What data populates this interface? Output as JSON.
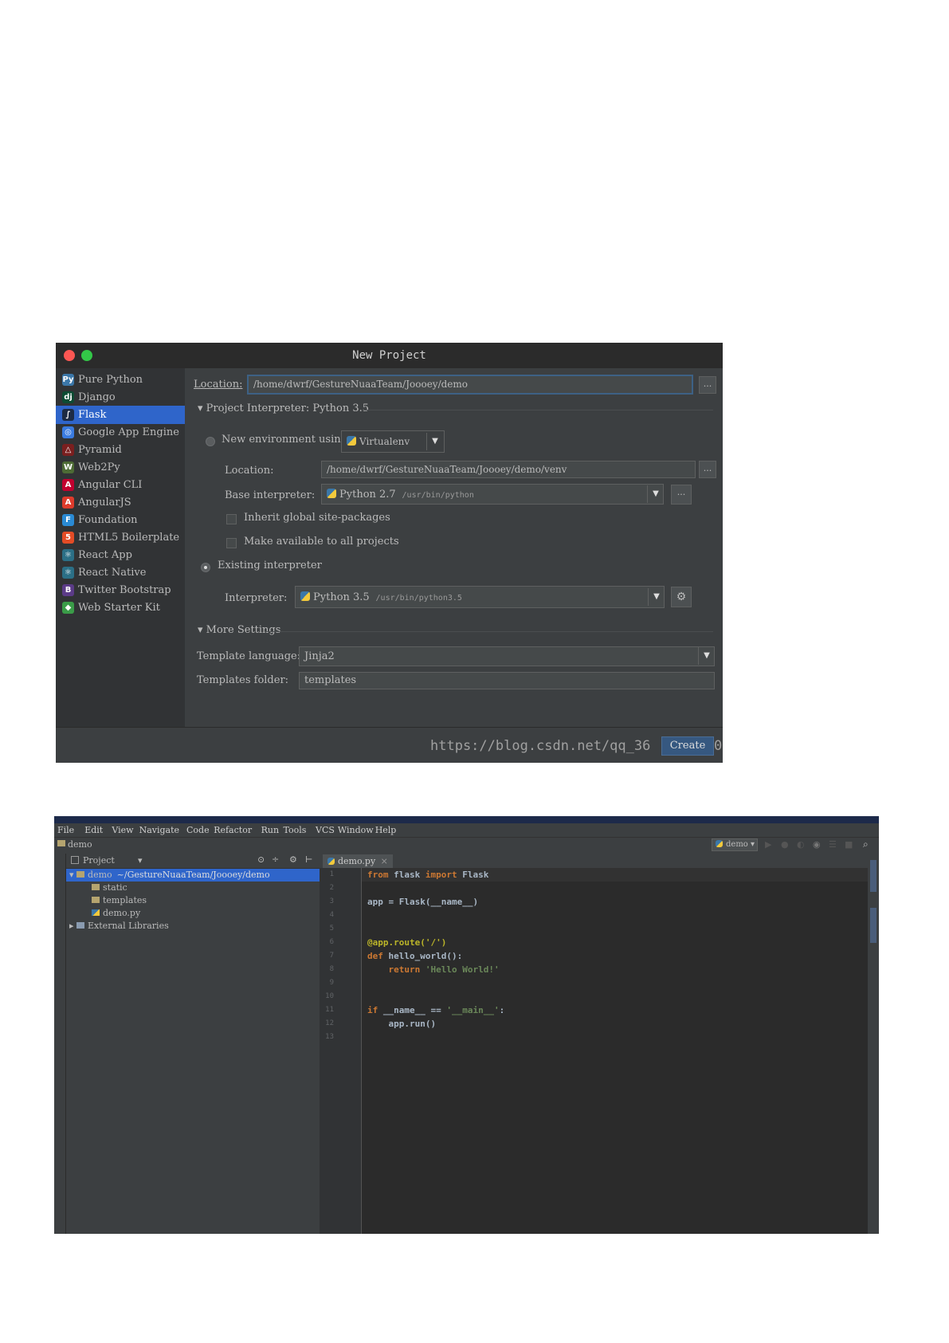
{
  "dialog": {
    "title": "New Project",
    "project_types": [
      {
        "label": "Pure Python",
        "icon": "python-icon"
      },
      {
        "label": "Django",
        "icon": "django-icon"
      },
      {
        "label": "Flask",
        "icon": "flask-icon"
      },
      {
        "label": "Google App Engine",
        "icon": "google-app-engine-icon"
      },
      {
        "label": "Pyramid",
        "icon": "pyramid-icon"
      },
      {
        "label": "Web2Py",
        "icon": "web2py-icon"
      },
      {
        "label": "Angular CLI",
        "icon": "angular-cli-icon"
      },
      {
        "label": "AngularJS",
        "icon": "angularjs-icon"
      },
      {
        "label": "Foundation",
        "icon": "foundation-icon"
      },
      {
        "label": "HTML5 Boilerplate",
        "icon": "html5-icon"
      },
      {
        "label": "React App",
        "icon": "react-icon"
      },
      {
        "label": "React Native",
        "icon": "react-native-icon"
      },
      {
        "label": "Twitter Bootstrap",
        "icon": "bootstrap-icon"
      },
      {
        "label": "Web Starter Kit",
        "icon": "web-starter-kit-icon"
      }
    ],
    "selected_type": "Flask",
    "location_label": "Location:",
    "location_value": "/home/dwrf/GestureNuaaTeam/Joooey/demo",
    "browse_label": "...",
    "interpreter_section": "Project Interpreter: Python 3.5",
    "new_env_label": "New environment using",
    "new_env_tool": "Virtualenv",
    "venv_location_label": "Location:",
    "venv_location_value": "/home/dwrf/GestureNuaaTeam/Joooey/demo/venv",
    "base_interp_label": "Base interpreter:",
    "base_interp_name": "Python 2.7",
    "base_interp_path": "/usr/bin/python",
    "inherit_label": "Inherit global site-packages",
    "make_available_label": "Make available to all projects",
    "existing_label": "Existing interpreter",
    "interp_label": "Interpreter:",
    "interp_name": "Python 3.5",
    "interp_path": "/usr/bin/python3.5",
    "more_settings": "More Settings",
    "template_lang_label": "Template language:",
    "template_lang_value": "Jinja2",
    "templates_folder_label": "Templates folder:",
    "templates_folder_value": "templates",
    "watermark": "https://blog.csdn.net/qq_36",
    "watermark_tail": "0",
    "create_label": "Create"
  },
  "ide": {
    "menu": [
      "File",
      "Edit",
      "View",
      "Navigate",
      "Code",
      "Refactor",
      "Run",
      "Tools",
      "VCS",
      "Window",
      "Help"
    ],
    "breadcrumb": "demo",
    "run_config": "demo",
    "project_header": "Project",
    "tree": [
      {
        "label": "demo",
        "detail": "~/GestureNuaaTeam/Joooey/demo",
        "indent": 0,
        "kind": "folder",
        "expanded": true,
        "selected": true
      },
      {
        "label": "static",
        "detail": "",
        "indent": 2,
        "kind": "folder",
        "expanded": false,
        "selected": false
      },
      {
        "label": "templates",
        "detail": "",
        "indent": 2,
        "kind": "folder",
        "expanded": false,
        "selected": false
      },
      {
        "label": "demo.py",
        "detail": "",
        "indent": 2,
        "kind": "file",
        "expanded": false,
        "selected": false
      },
      {
        "label": "External Libraries",
        "detail": "",
        "indent": 0,
        "kind": "library",
        "expanded": false,
        "selected": false
      }
    ],
    "tab": "demo.py",
    "line_numbers": [
      "1",
      "2",
      "3",
      "4",
      "5",
      "6",
      "7",
      "8",
      "9",
      "10",
      "11",
      "12",
      "13"
    ],
    "code_lines": [
      [
        {
          "t": "from",
          "c": "kw"
        },
        {
          "t": " flask ",
          "c": ""
        },
        {
          "t": "import",
          "c": "kw"
        },
        {
          "t": " Flask",
          "c": ""
        }
      ],
      [],
      [
        {
          "t": "app = Flask(__name__)",
          "c": ""
        }
      ],
      [],
      [],
      [
        {
          "t": "@app.route('/')",
          "c": "dec"
        }
      ],
      [
        {
          "t": "def",
          "c": "kw"
        },
        {
          "t": " hello_world():",
          "c": ""
        }
      ],
      [
        {
          "t": "    ",
          "c": ""
        },
        {
          "t": "return",
          "c": "kw"
        },
        {
          "t": " ",
          "c": ""
        },
        {
          "t": "'Hello World!'",
          "c": "str"
        }
      ],
      [],
      [],
      [
        {
          "t": "if",
          "c": "kw"
        },
        {
          "t": " __name__ == ",
          "c": ""
        },
        {
          "t": "'__main__'",
          "c": "str"
        },
        {
          "t": ":",
          "c": ""
        }
      ],
      [
        {
          "t": "    app.run()",
          "c": ""
        }
      ],
      []
    ]
  }
}
